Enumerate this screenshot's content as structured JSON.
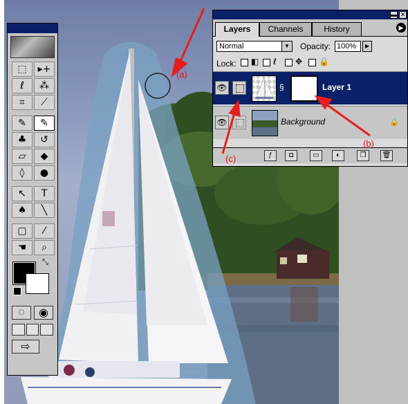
{
  "toolbox": {
    "tools": [
      {
        "name": "marquee-tool",
        "glyph": "⬚"
      },
      {
        "name": "move-tool",
        "glyph": "▸+"
      },
      {
        "name": "lasso-tool",
        "glyph": "ℓ"
      },
      {
        "name": "magic-wand-tool",
        "glyph": "⁂"
      },
      {
        "name": "crop-tool",
        "glyph": "⌗"
      },
      {
        "name": "slice-tool",
        "glyph": "⟋"
      },
      {
        "name": "healing-tool",
        "glyph": "✎"
      },
      {
        "name": "brush-tool",
        "glyph": "✎"
      },
      {
        "name": "stamp-tool",
        "glyph": "♣"
      },
      {
        "name": "history-brush-tool",
        "glyph": "↺"
      },
      {
        "name": "eraser-tool",
        "glyph": "▱"
      },
      {
        "name": "paint-bucket-tool",
        "glyph": "◆"
      },
      {
        "name": "blur-tool",
        "glyph": "◊"
      },
      {
        "name": "burn-tool",
        "glyph": "●"
      },
      {
        "name": "selection-tool",
        "glyph": "↖"
      },
      {
        "name": "type-tool",
        "glyph": "T"
      },
      {
        "name": "pen-tool",
        "glyph": "♠"
      },
      {
        "name": "line-tool",
        "glyph": "╲"
      },
      {
        "name": "notes-tool",
        "glyph": "▢"
      },
      {
        "name": "eyedropper-tool",
        "glyph": "⁄"
      },
      {
        "name": "hand-tool",
        "glyph": "☚"
      },
      {
        "name": "zoom-tool",
        "glyph": "⌕"
      }
    ],
    "foreground_color": "#000000",
    "background_color": "#ffffff"
  },
  "layers_palette": {
    "tabs": [
      "Layers",
      "Channels",
      "History"
    ],
    "active_tab": "Layers",
    "blend_mode": "Normal",
    "opacity_label": "Opacity:",
    "opacity_value": "100%",
    "lock_label": "Lock:",
    "layers": [
      {
        "name": "Layer 1",
        "selected": true,
        "visible": true,
        "has_mask": true
      },
      {
        "name": "Background",
        "selected": false,
        "visible": true,
        "locked": true
      }
    ],
    "bottom_buttons": [
      "layer-style",
      "add-mask",
      "new-set",
      "adjustment-layer",
      "new-layer",
      "delete-layer"
    ]
  },
  "annotations": {
    "a": "(a)",
    "b": "(b)",
    "c": "(c)"
  }
}
